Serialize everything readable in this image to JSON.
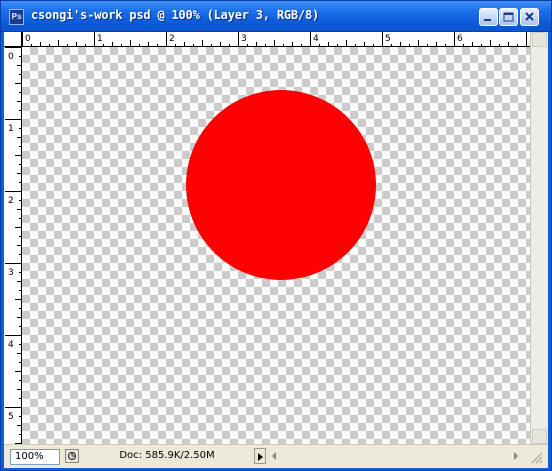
{
  "window": {
    "title": "csongi's-work psd @ 100% (Layer 3, RGB/8)",
    "app_icon_label": "Ps",
    "app_icon": "photoshop-document-icon",
    "buttons": {
      "minimize": "minimize-icon",
      "maximize": "maximize-icon",
      "close": "close-icon"
    }
  },
  "rulers": {
    "horizontal_labels": [
      "0",
      "1",
      "2",
      "3",
      "4",
      "5",
      "6"
    ],
    "vertical_labels": [
      "0",
      "1",
      "2",
      "3",
      "4",
      "5"
    ],
    "unit": "inches"
  },
  "canvas": {
    "background": "transparency-checkerboard",
    "shape": "circle",
    "shape_color": "#ff0000"
  },
  "statusbar": {
    "zoom": "100%",
    "doc_info": "Doc: 585.9K/2.50M"
  },
  "colors": {
    "titlebar": "#0b5fd8",
    "chrome": "#ece9d8",
    "fill": "#ff0000"
  }
}
